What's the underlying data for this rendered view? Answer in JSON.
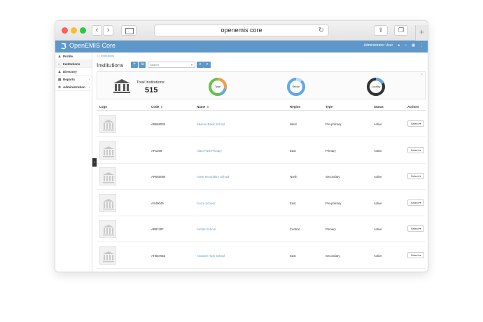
{
  "browser": {
    "url": "openemis core",
    "back_icon": "chevron-left-icon",
    "forward_icon": "chevron-right-icon"
  },
  "app": {
    "title": "OpenEMIS Core",
    "user_label": "Administrator User"
  },
  "sidebar": {
    "items": [
      {
        "label": "Profile",
        "icon": "user-icon"
      },
      {
        "label": "Institutions",
        "icon": "institution-icon"
      },
      {
        "label": "Directory",
        "icon": "users-icon"
      },
      {
        "label": "Reports",
        "icon": "chart-icon"
      },
      {
        "label": "Administration",
        "icon": "cogs-icon"
      }
    ]
  },
  "breadcrumb": {
    "home": "⌂",
    "separator": "›",
    "current": "Institutions"
  },
  "page": {
    "title": "Institutions"
  },
  "search": {
    "placeholder": "Search"
  },
  "stats": {
    "total_label": "Total Institutions:",
    "total_value": "515",
    "donuts": [
      {
        "label": "Type"
      },
      {
        "label": "Sector"
      },
      {
        "label": "Locality"
      }
    ]
  },
  "table": {
    "columns": [
      "Logo",
      "Code",
      "Name",
      "Region",
      "Type",
      "Status",
      "Actions"
    ],
    "sort_glyph": "⇕",
    "action_label": "Select ▾",
    "rows": [
      {
        "code": "AB568039",
        "name": "Abacus Basic School",
        "region": "West",
        "type": "Pre-primary",
        "status": "Active"
      },
      {
        "code": "AP1269",
        "name": "Alam Park Primary",
        "region": "East",
        "type": "Primary",
        "status": "Active"
      },
      {
        "code": "AR650090",
        "name": "Aram Secondary School",
        "region": "North",
        "type": "Secondary",
        "status": "Active"
      },
      {
        "code": "AS49049",
        "name": "Acorn School",
        "region": "East",
        "type": "Pre-primary",
        "status": "Active"
      },
      {
        "code": "AB97497",
        "name": "Ambar School",
        "region": "Central",
        "type": "Primary",
        "status": "Active"
      },
      {
        "code": "AH557653",
        "name": "Andover High School",
        "region": "East",
        "type": "Secondary",
        "status": "Active"
      }
    ]
  },
  "colors": {
    "brand": "#5e97c9",
    "donut_green": "#6abf4b",
    "donut_orange": "#f0a04b",
    "donut_blue": "#5da9e9",
    "donut_dark": "#333333"
  }
}
